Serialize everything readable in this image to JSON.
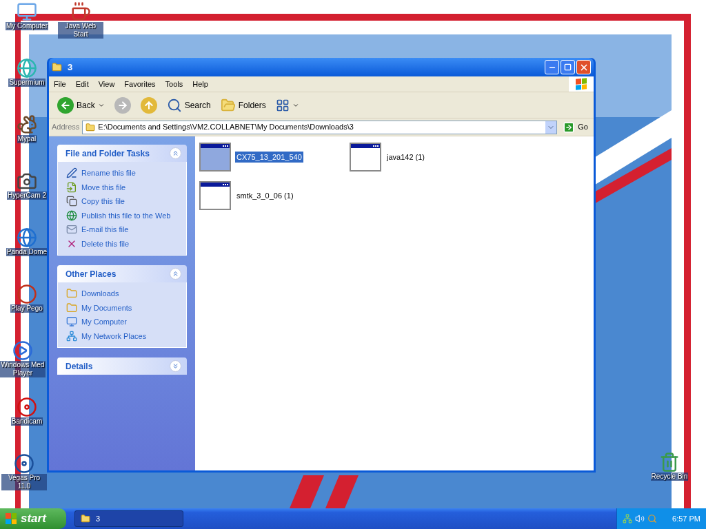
{
  "desktop": {
    "icons": [
      {
        "label": "My Computer",
        "kind": "computer"
      },
      {
        "label": "Java Web Start",
        "kind": "java"
      },
      {
        "label": "Supermium",
        "kind": "supermium"
      },
      {
        "label": "Mypal",
        "kind": "mypal"
      },
      {
        "label": "HyperCam 2",
        "kind": "camera"
      },
      {
        "label": "Panda Dome",
        "kind": "panda"
      },
      {
        "label": "Play Pego",
        "kind": "pego"
      },
      {
        "label": "Windows Med Player",
        "kind": "media"
      },
      {
        "label": "Bandicam",
        "kind": "record"
      },
      {
        "label": "Vegas Pro 11.0",
        "kind": "vegas"
      },
      {
        "label": "Recycle Bin",
        "kind": "recycle"
      }
    ]
  },
  "window": {
    "title": "3",
    "menu": [
      "File",
      "Edit",
      "View",
      "Favorites",
      "Tools",
      "Help"
    ],
    "toolbar": [
      {
        "label": "Back",
        "kind": "back"
      },
      {
        "kind": "forward"
      },
      {
        "kind": "up"
      },
      {
        "label": "Search",
        "kind": "search"
      },
      {
        "label": "Folders",
        "kind": "folders"
      },
      {
        "kind": "views"
      }
    ],
    "address": {
      "label": "Address",
      "value": "E:\\Documents and Settings\\VM2.COLLABNET\\My Documents\\Downloads\\3",
      "go": "Go"
    },
    "panels": [
      {
        "title": "File and Folder Tasks",
        "expanded": true,
        "items": [
          {
            "label": "Rename this file",
            "kind": "rename"
          },
          {
            "label": "Move this file",
            "kind": "move"
          },
          {
            "label": "Copy this file",
            "kind": "copy"
          },
          {
            "label": "Publish this file to the Web",
            "kind": "web"
          },
          {
            "label": "E-mail this file",
            "kind": "mail"
          },
          {
            "label": "Delete this file",
            "kind": "delete"
          }
        ]
      },
      {
        "title": "Other Places",
        "expanded": true,
        "items": [
          {
            "label": "Downloads",
            "kind": "folder"
          },
          {
            "label": "My Documents",
            "kind": "folder"
          },
          {
            "label": "My Computer",
            "kind": "computer"
          },
          {
            "label": "My Network Places",
            "kind": "network"
          }
        ]
      },
      {
        "title": "Details",
        "expanded": false
      }
    ],
    "files": [
      {
        "name": "CX75_13_201_540",
        "selected": true
      },
      {
        "name": "java142 (1)",
        "selected": false
      },
      {
        "name": "smtk_3_0_06 (1)",
        "selected": false
      }
    ]
  },
  "taskbar": {
    "start": "start",
    "tasks": [
      {
        "label": "3",
        "selected": true
      }
    ],
    "clock": "6:57 PM"
  }
}
